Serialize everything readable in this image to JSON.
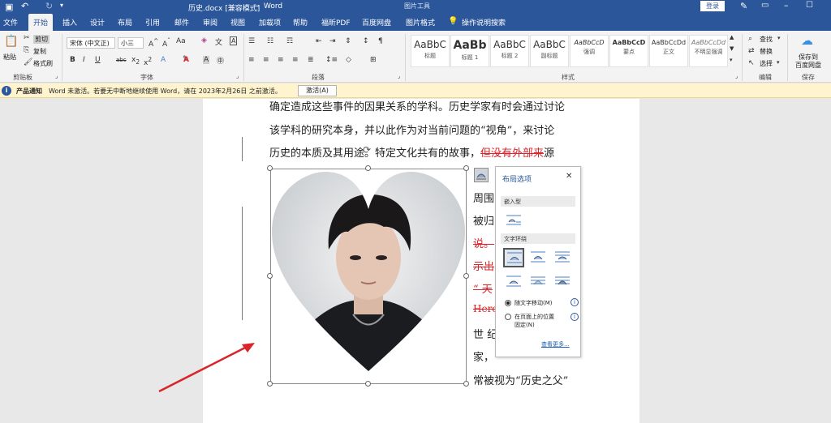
{
  "titlebar": {
    "doc_title": "历史.docx [兼容模式]",
    "app_name": "Word",
    "context_tab": "图片工具",
    "login": "登录"
  },
  "tabs": [
    "文件",
    "开始",
    "插入",
    "设计",
    "布局",
    "引用",
    "邮件",
    "审阅",
    "视图",
    "加载项",
    "帮助",
    "福昕PDF",
    "百度网盘",
    "图片格式"
  ],
  "tell_me": "操作说明搜索",
  "ribbon": {
    "clipboard": {
      "paste": "粘贴",
      "cut": "剪切",
      "copy": "复制",
      "format_painter": "格式刷",
      "label": "剪贴板"
    },
    "font": {
      "font_name": "宋体 (中文正)",
      "font_size": "小三",
      "label": "字体"
    },
    "paragraph": {
      "label": "段落"
    },
    "styles": {
      "label": "样式",
      "items": [
        {
          "sample": "AaBbC",
          "name": "标题"
        },
        {
          "sample": "AaBb",
          "name": "标题 1"
        },
        {
          "sample": "AaBbC",
          "name": "标题 2"
        },
        {
          "sample": "AaBbC",
          "name": "副标题"
        },
        {
          "sample": "AaBbCcD",
          "name": "强调"
        },
        {
          "sample": "AaBbCcD",
          "name": "要点"
        },
        {
          "sample": "AaBbCcDd",
          "name": "正文"
        },
        {
          "sample": "AaBbCcDd",
          "name": "不明显强调"
        }
      ]
    },
    "editing": {
      "find": "查找",
      "replace": "替换",
      "select": "选择",
      "label": "编辑"
    },
    "save": {
      "line1": "保存到",
      "line2": "百度网盘",
      "label": "保存"
    }
  },
  "notify": {
    "tag": "产品通知",
    "message": "Word 未激活。若要无中断地继续使用 Word，请在 2023年2月26日 之前激活。",
    "button": "激活(A)"
  },
  "document": {
    "lines": [
      "确定造成这些事件的因果关系的学科。历史学家有时会通过讨论",
      "该学科的研究本身，并以此作为对当前问题的“视角”，来讨论"
    ],
    "line3_a": "历史的本质及其用途。特定文化共有的故事，",
    "line3_red": "但没有外部来",
    "line3_b": "源",
    "right_frag": [
      {
        "text": "周围",
        "red": false
      },
      {
        "text": "被归",
        "red": false
      },
      {
        "text": "说。",
        "red": true
      },
      {
        "text": "示出",
        "red": true
      },
      {
        "text": "“ 天",
        "red": true
      },
      {
        "text": "Hero",
        "red": true
      },
      {
        "text": "世 纪",
        "red": false
      },
      {
        "text": "家，",
        "red": false
      }
    ],
    "last_line": "常被视为“历史之父”"
  },
  "layout_panel": {
    "title": "布局选项",
    "inline_header": "嵌入型",
    "wrap_header": "文字环绕",
    "radio1": "随文字移动(M)",
    "radio2_line1": "在页面上的位置",
    "radio2_line2": "固定(N)",
    "see_more": "查看更多..."
  },
  "colors": {
    "title_blue": "#2b579a",
    "accent_red": "#d9242a",
    "notify_bg": "#fff4ce",
    "link_blue": "#1e5fb4"
  }
}
